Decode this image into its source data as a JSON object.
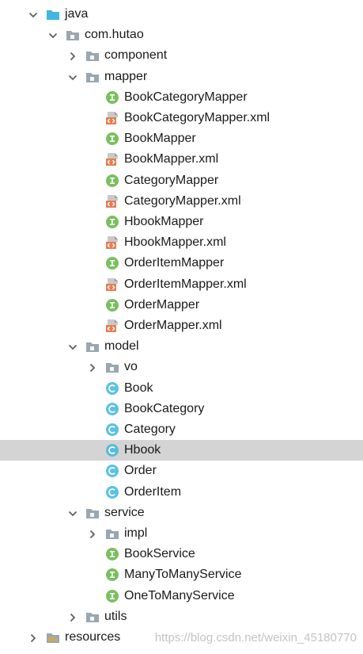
{
  "project_tree": {
    "nodes": [
      {
        "label": "java",
        "depth": 0,
        "type": "source-folder",
        "state": "expanded"
      },
      {
        "label": "com.hutao",
        "depth": 1,
        "type": "package",
        "state": "expanded"
      },
      {
        "label": "component",
        "depth": 2,
        "type": "package",
        "state": "collapsed"
      },
      {
        "label": "mapper",
        "depth": 2,
        "type": "package",
        "state": "expanded"
      },
      {
        "label": "BookCategoryMapper",
        "depth": 3,
        "type": "interface",
        "state": "leaf"
      },
      {
        "label": "BookCategoryMapper.xml",
        "depth": 3,
        "type": "xml",
        "state": "leaf"
      },
      {
        "label": "BookMapper",
        "depth": 3,
        "type": "interface",
        "state": "leaf"
      },
      {
        "label": "BookMapper.xml",
        "depth": 3,
        "type": "xml",
        "state": "leaf"
      },
      {
        "label": "CategoryMapper",
        "depth": 3,
        "type": "interface",
        "state": "leaf"
      },
      {
        "label": "CategoryMapper.xml",
        "depth": 3,
        "type": "xml",
        "state": "leaf"
      },
      {
        "label": "HbookMapper",
        "depth": 3,
        "type": "interface",
        "state": "leaf"
      },
      {
        "label": "HbookMapper.xml",
        "depth": 3,
        "type": "xml",
        "state": "leaf"
      },
      {
        "label": "OrderItemMapper",
        "depth": 3,
        "type": "interface",
        "state": "leaf"
      },
      {
        "label": "OrderItemMapper.xml",
        "depth": 3,
        "type": "xml",
        "state": "leaf"
      },
      {
        "label": "OrderMapper",
        "depth": 3,
        "type": "interface",
        "state": "leaf"
      },
      {
        "label": "OrderMapper.xml",
        "depth": 3,
        "type": "xml",
        "state": "leaf"
      },
      {
        "label": "model",
        "depth": 2,
        "type": "package",
        "state": "expanded"
      },
      {
        "label": "vo",
        "depth": 3,
        "type": "package",
        "state": "collapsed"
      },
      {
        "label": "Book",
        "depth": 3,
        "type": "class",
        "state": "leaf"
      },
      {
        "label": "BookCategory",
        "depth": 3,
        "type": "class",
        "state": "leaf"
      },
      {
        "label": "Category",
        "depth": 3,
        "type": "class",
        "state": "leaf"
      },
      {
        "label": "Hbook",
        "depth": 3,
        "type": "class",
        "state": "leaf",
        "selected": true
      },
      {
        "label": "Order",
        "depth": 3,
        "type": "class",
        "state": "leaf"
      },
      {
        "label": "OrderItem",
        "depth": 3,
        "type": "class",
        "state": "leaf"
      },
      {
        "label": "service",
        "depth": 2,
        "type": "package",
        "state": "expanded"
      },
      {
        "label": "impl",
        "depth": 3,
        "type": "package",
        "state": "collapsed"
      },
      {
        "label": "BookService",
        "depth": 3,
        "type": "interface",
        "state": "leaf"
      },
      {
        "label": "ManyToManyService",
        "depth": 3,
        "type": "interface",
        "state": "leaf"
      },
      {
        "label": "OneToManyService",
        "depth": 3,
        "type": "interface",
        "state": "leaf"
      },
      {
        "label": "utils",
        "depth": 2,
        "type": "package",
        "state": "collapsed"
      },
      {
        "label": "resources",
        "depth": 0,
        "type": "resources-folder",
        "state": "collapsed"
      }
    ]
  },
  "watermark": {
    "text": "https://blog.csdn.net/weixin_45180770"
  },
  "colors": {
    "selected_row": "#d4d4d4",
    "interface_icon": "#62b543",
    "class_icon": "#40b6e0",
    "package_icon": "#9aa7b0",
    "source_folder_icon": "#40b6e0",
    "xml_icon": "#e57f53",
    "arrow": "#606060"
  },
  "icons": {
    "expanded": "chevron-down-icon",
    "collapsed": "chevron-right-icon",
    "source-folder": "source-folder-icon",
    "resources-folder": "resources-folder-icon",
    "package": "package-icon",
    "interface": "interface-icon",
    "class": "class-icon",
    "xml": "xml-file-icon"
  }
}
